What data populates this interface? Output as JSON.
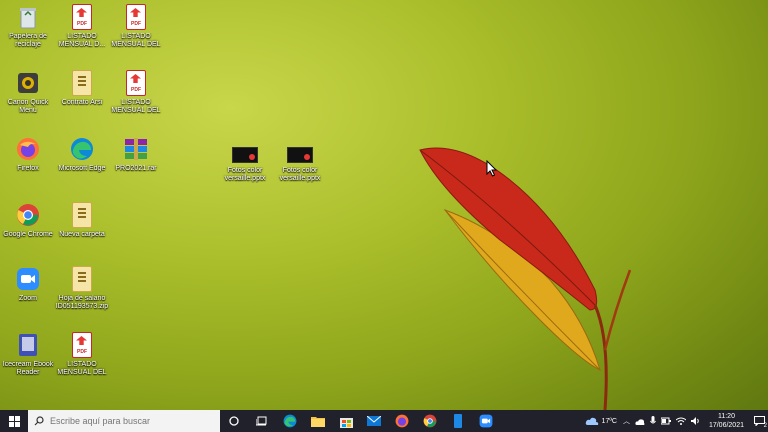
{
  "desktop_icons": [
    {
      "label": "Papelera de reciclaje",
      "type": "recycle"
    },
    {
      "label": "LISTADO MENSUAL D...",
      "type": "pdf"
    },
    {
      "label": "LISTADO MENSUAL DEL ...",
      "type": "pdf"
    },
    {
      "label": "Canon Quick Menu",
      "type": "app"
    },
    {
      "label": "Contrato Arsi",
      "type": "file"
    },
    {
      "label": "LISTADO MENSUAL DEL ...",
      "type": "pdf"
    },
    {
      "label": "Firefox",
      "type": "firefox"
    },
    {
      "label": "Microsoft Edge",
      "type": "edge"
    },
    {
      "label": "PRO2021.rar",
      "type": "rar"
    },
    {
      "label": "Fotos color versaille.pptx",
      "type": "thumb"
    },
    {
      "label": "Fotos color versaille.pptx",
      "type": "thumb"
    },
    {
      "label": "Google Chrome",
      "type": "chrome"
    },
    {
      "label": "Nueva carpeta",
      "type": "file"
    },
    {
      "label": "Zoom",
      "type": "zoom"
    },
    {
      "label": "Hoja de salario ID051193573.zip",
      "type": "file"
    },
    {
      "label": "Icecream Ebook Reader",
      "type": "ebook"
    },
    {
      "label": "LISTADO MENSUAL DEL ...",
      "type": "pdf"
    }
  ],
  "taskbar": {
    "search_placeholder": "Escribe aquí para buscar",
    "temperature": "17ºC",
    "time": "11:20",
    "date": "17/06/2021",
    "notification_count": "2"
  }
}
